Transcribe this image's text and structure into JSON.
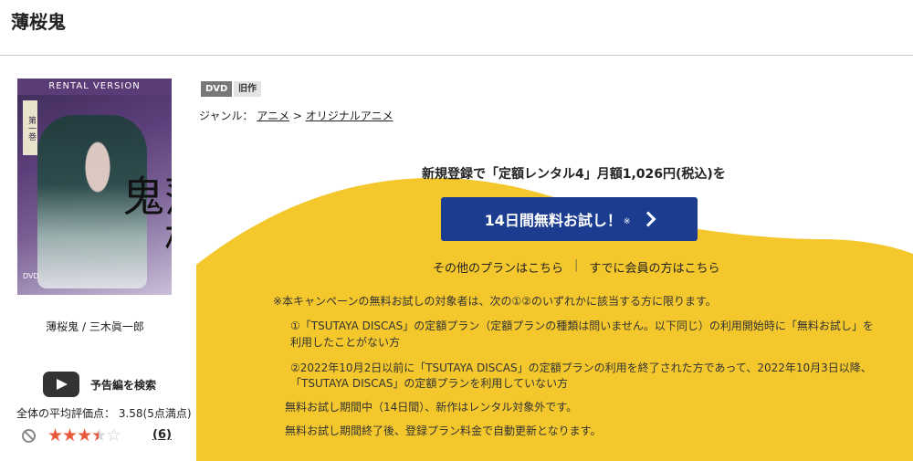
{
  "header": {
    "title": "薄桜鬼"
  },
  "cover": {
    "band_text": "RENTAL VERSION",
    "volume_text": "第一巻",
    "title_art": "薄桜鬼",
    "caption": "薄桜鬼 / 三木眞一郎"
  },
  "trailer": {
    "label": "予告編を検索"
  },
  "rating": {
    "average_text": "全体の平均評価点： 3.58(5点満点)",
    "stars_full": "★★★",
    "stars_half": "★",
    "stars_empty": "☆",
    "value": 3.58,
    "max": 5,
    "count": "(6)"
  },
  "badges": {
    "dvd": "DVD",
    "old": "旧作"
  },
  "genre": {
    "label": "ジャンル：",
    "link1": "アニメ",
    "arrow": ">",
    "link2": "オリジナルアニメ"
  },
  "promo": {
    "headline": "新規登録で「定額レンタル4」月額1,026円(税込)を",
    "cta_label": "14日間無料お試し！",
    "cta_note": "※",
    "other_plans": "その他のプランはこちら",
    "separator": "|",
    "members": "すでに会員の方はこちら"
  },
  "notes": {
    "intro": "※本キャンペーンの無料お試しの対象者は、次の①②のいずれかに該当する方に限ります。",
    "item1_line1": "①「TSUTAYA DISCAS」の定額プラン（定額プランの種類は問いません。以下同じ）の利用開始時に「無料お試し」を",
    "item1_line2": "利用したことがない方",
    "item2_line1": "②2022年10月2日以前に「TSUTAYA DISCAS」の定額プランの利用を終了された方であって、2022年10月3日以降、",
    "item2_line2": "「TSUTAYA DISCAS」の定額プランを利用していない方",
    "trial_period": "無料お試し期間中（14日間）、新作はレンタル対象外です。",
    "auto_renew": "無料お試し期間終了後、登録プラン料金で自動更新となります。"
  },
  "colors": {
    "accent_yellow": "#f4c82d",
    "cta_blue": "#1b3c8f",
    "star": "#e8583b"
  }
}
